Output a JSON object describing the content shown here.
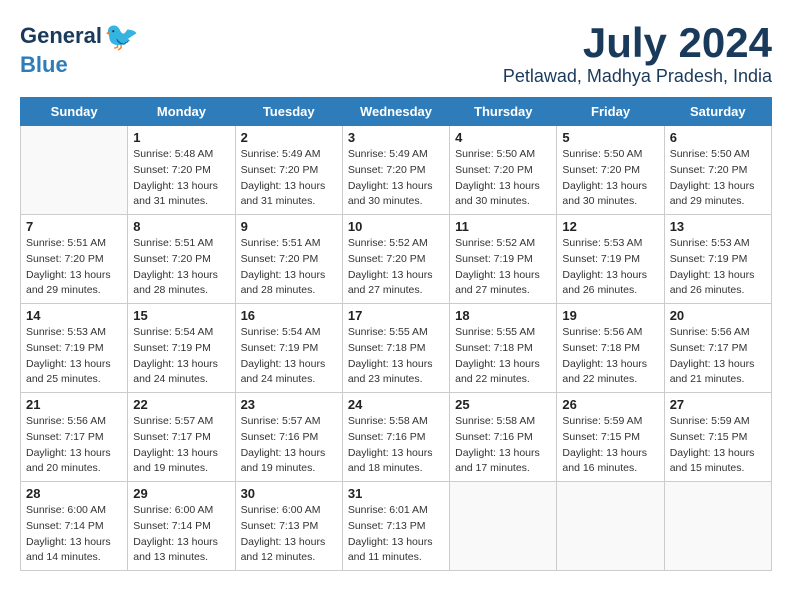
{
  "header": {
    "logo_general": "General",
    "logo_blue": "Blue",
    "month_year": "July 2024",
    "location": "Petlawad, Madhya Pradesh, India"
  },
  "calendar": {
    "days_of_week": [
      "Sunday",
      "Monday",
      "Tuesday",
      "Wednesday",
      "Thursday",
      "Friday",
      "Saturday"
    ],
    "weeks": [
      [
        {
          "day": "",
          "info": ""
        },
        {
          "day": "1",
          "info": "Sunrise: 5:48 AM\nSunset: 7:20 PM\nDaylight: 13 hours\nand 31 minutes."
        },
        {
          "day": "2",
          "info": "Sunrise: 5:49 AM\nSunset: 7:20 PM\nDaylight: 13 hours\nand 31 minutes."
        },
        {
          "day": "3",
          "info": "Sunrise: 5:49 AM\nSunset: 7:20 PM\nDaylight: 13 hours\nand 30 minutes."
        },
        {
          "day": "4",
          "info": "Sunrise: 5:50 AM\nSunset: 7:20 PM\nDaylight: 13 hours\nand 30 minutes."
        },
        {
          "day": "5",
          "info": "Sunrise: 5:50 AM\nSunset: 7:20 PM\nDaylight: 13 hours\nand 30 minutes."
        },
        {
          "day": "6",
          "info": "Sunrise: 5:50 AM\nSunset: 7:20 PM\nDaylight: 13 hours\nand 29 minutes."
        }
      ],
      [
        {
          "day": "7",
          "info": "Sunrise: 5:51 AM\nSunset: 7:20 PM\nDaylight: 13 hours\nand 29 minutes."
        },
        {
          "day": "8",
          "info": "Sunrise: 5:51 AM\nSunset: 7:20 PM\nDaylight: 13 hours\nand 28 minutes."
        },
        {
          "day": "9",
          "info": "Sunrise: 5:51 AM\nSunset: 7:20 PM\nDaylight: 13 hours\nand 28 minutes."
        },
        {
          "day": "10",
          "info": "Sunrise: 5:52 AM\nSunset: 7:20 PM\nDaylight: 13 hours\nand 27 minutes."
        },
        {
          "day": "11",
          "info": "Sunrise: 5:52 AM\nSunset: 7:19 PM\nDaylight: 13 hours\nand 27 minutes."
        },
        {
          "day": "12",
          "info": "Sunrise: 5:53 AM\nSunset: 7:19 PM\nDaylight: 13 hours\nand 26 minutes."
        },
        {
          "day": "13",
          "info": "Sunrise: 5:53 AM\nSunset: 7:19 PM\nDaylight: 13 hours\nand 26 minutes."
        }
      ],
      [
        {
          "day": "14",
          "info": "Sunrise: 5:53 AM\nSunset: 7:19 PM\nDaylight: 13 hours\nand 25 minutes."
        },
        {
          "day": "15",
          "info": "Sunrise: 5:54 AM\nSunset: 7:19 PM\nDaylight: 13 hours\nand 24 minutes."
        },
        {
          "day": "16",
          "info": "Sunrise: 5:54 AM\nSunset: 7:19 PM\nDaylight: 13 hours\nand 24 minutes."
        },
        {
          "day": "17",
          "info": "Sunrise: 5:55 AM\nSunset: 7:18 PM\nDaylight: 13 hours\nand 23 minutes."
        },
        {
          "day": "18",
          "info": "Sunrise: 5:55 AM\nSunset: 7:18 PM\nDaylight: 13 hours\nand 22 minutes."
        },
        {
          "day": "19",
          "info": "Sunrise: 5:56 AM\nSunset: 7:18 PM\nDaylight: 13 hours\nand 22 minutes."
        },
        {
          "day": "20",
          "info": "Sunrise: 5:56 AM\nSunset: 7:17 PM\nDaylight: 13 hours\nand 21 minutes."
        }
      ],
      [
        {
          "day": "21",
          "info": "Sunrise: 5:56 AM\nSunset: 7:17 PM\nDaylight: 13 hours\nand 20 minutes."
        },
        {
          "day": "22",
          "info": "Sunrise: 5:57 AM\nSunset: 7:17 PM\nDaylight: 13 hours\nand 19 minutes."
        },
        {
          "day": "23",
          "info": "Sunrise: 5:57 AM\nSunset: 7:16 PM\nDaylight: 13 hours\nand 19 minutes."
        },
        {
          "day": "24",
          "info": "Sunrise: 5:58 AM\nSunset: 7:16 PM\nDaylight: 13 hours\nand 18 minutes."
        },
        {
          "day": "25",
          "info": "Sunrise: 5:58 AM\nSunset: 7:16 PM\nDaylight: 13 hours\nand 17 minutes."
        },
        {
          "day": "26",
          "info": "Sunrise: 5:59 AM\nSunset: 7:15 PM\nDaylight: 13 hours\nand 16 minutes."
        },
        {
          "day": "27",
          "info": "Sunrise: 5:59 AM\nSunset: 7:15 PM\nDaylight: 13 hours\nand 15 minutes."
        }
      ],
      [
        {
          "day": "28",
          "info": "Sunrise: 6:00 AM\nSunset: 7:14 PM\nDaylight: 13 hours\nand 14 minutes."
        },
        {
          "day": "29",
          "info": "Sunrise: 6:00 AM\nSunset: 7:14 PM\nDaylight: 13 hours\nand 13 minutes."
        },
        {
          "day": "30",
          "info": "Sunrise: 6:00 AM\nSunset: 7:13 PM\nDaylight: 13 hours\nand 12 minutes."
        },
        {
          "day": "31",
          "info": "Sunrise: 6:01 AM\nSunset: 7:13 PM\nDaylight: 13 hours\nand 11 minutes."
        },
        {
          "day": "",
          "info": ""
        },
        {
          "day": "",
          "info": ""
        },
        {
          "day": "",
          "info": ""
        }
      ]
    ]
  }
}
